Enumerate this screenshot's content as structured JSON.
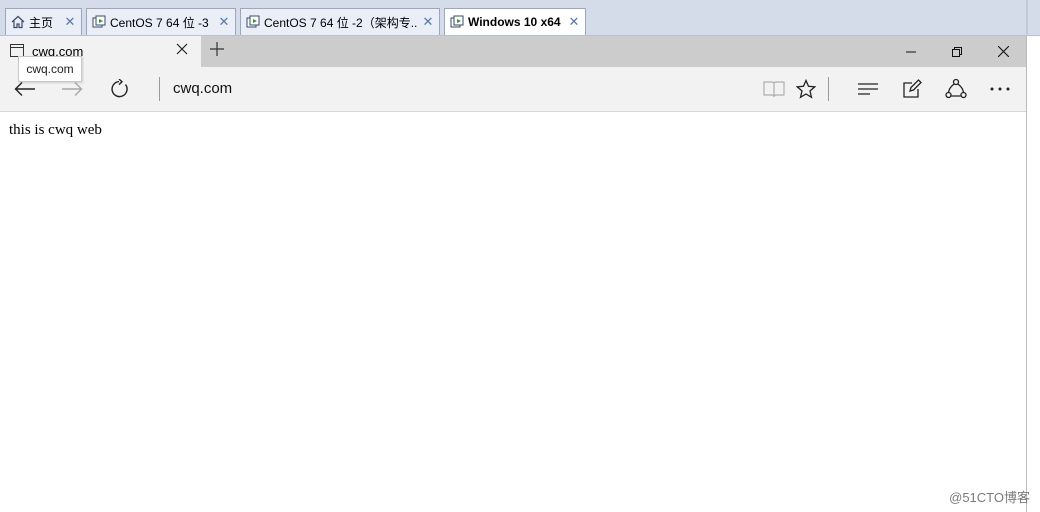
{
  "vm_tabs": [
    {
      "label": "主页",
      "icon": "home-icon",
      "active": false
    },
    {
      "label": "CentOS 7 64 位 -3",
      "icon": "vm-icon",
      "active": false
    },
    {
      "label": "CentOS 7 64 位 -2（架构专...",
      "icon": "vm-icon",
      "active": false
    },
    {
      "label": "Windows 10 x64",
      "icon": "vm-icon",
      "active": true
    }
  ],
  "edge": {
    "tab_title": "cwq.com",
    "tooltip": "cwq.com",
    "address": "cwq.com"
  },
  "page": {
    "body_text": "this is cwq web"
  },
  "watermark": "@51CTO博客"
}
